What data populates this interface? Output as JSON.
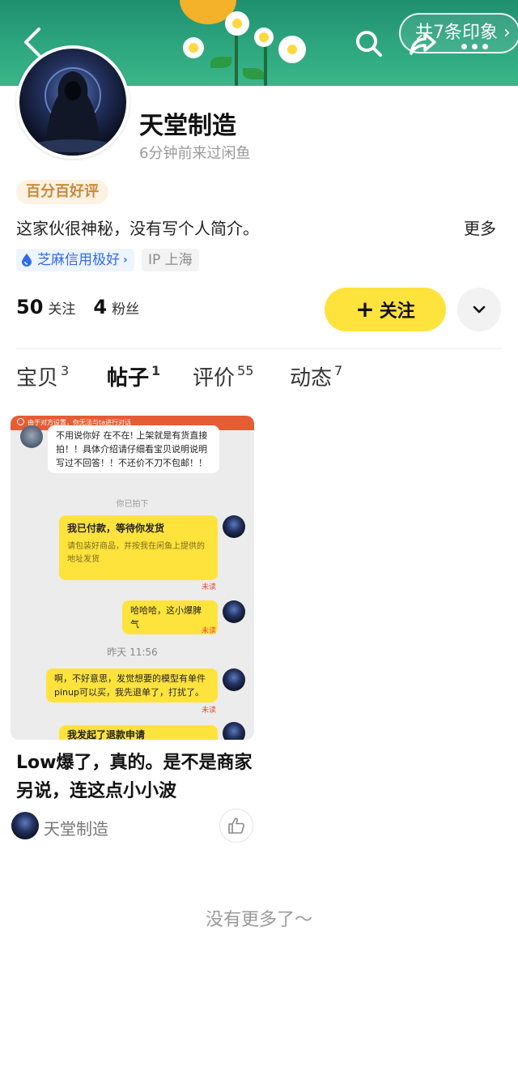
{
  "header": {
    "impression_label": "共7条印象 ›"
  },
  "profile": {
    "username": "天堂制造",
    "last_seen": "6分钟前来过闲鱼",
    "tag": "百分百好评",
    "bio": "这家伙很神秘，没有写个人简介。",
    "bio_more": "更多",
    "credit_label": "芝麻信用极好",
    "credit_chevron": "›",
    "ip_label": "IP 上海",
    "following_count": "50",
    "following_label": "关注",
    "followers_count": "4",
    "followers_label": "粉丝",
    "follow_button_plus": "+",
    "follow_button_label": "关注"
  },
  "tabs": [
    {
      "label": "宝贝",
      "count": "3"
    },
    {
      "label": "帖子",
      "count": "1"
    },
    {
      "label": "评价",
      "count": "55"
    },
    {
      "label": "动态",
      "count": "7"
    }
  ],
  "post": {
    "chat": {
      "banner": "由于对方设置，你无法与ta进行对话",
      "msg1": "不用说你好 在不在! 上架就是有货直接拍！！具体介绍请仔细看宝贝说明说明写过不回答！！不还价不刀不包邮！！",
      "system1": "你已拍下",
      "msg2_title": "我已付款，等待你发货",
      "msg2_sub": "请包装好商品，并按我在闲鱼上提供的地址发货",
      "unread1": "未读",
      "msg3": "哈哈哈，这小爆脾气",
      "unread2": "未读",
      "time": "昨天 11:56",
      "msg4": "啊，不好意思，发觉想要的模型有单件pinup可以买，我先退单了，打扰了。",
      "unread3": "未读",
      "msg5": "我发起了退款申请"
    },
    "title": "Low爆了，真的。是不是商家另说，连这点小小波",
    "author": "天堂制造"
  },
  "footer": {
    "no_more": "没有更多了～"
  }
}
